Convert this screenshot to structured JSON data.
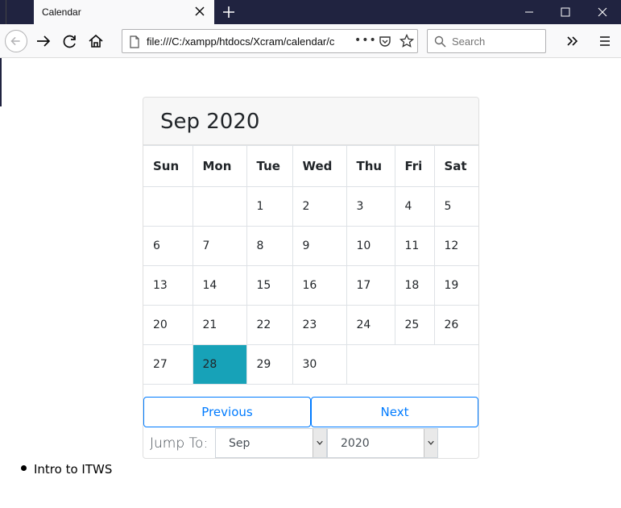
{
  "browser": {
    "tab_title": "Calendar",
    "url": "file:///C:/xampp/htdocs/Xcram/calendar/c",
    "more_label": "•••",
    "search_placeholder": "Search"
  },
  "calendar": {
    "header": "Sep 2020",
    "weekdays": [
      "Sun",
      "Mon",
      "Tue",
      "Wed",
      "Thu",
      "Fri",
      "Sat"
    ],
    "weeks": [
      [
        "",
        "",
        "1",
        "2",
        "3",
        "4",
        "5"
      ],
      [
        "6",
        "7",
        "8",
        "9",
        "10",
        "11",
        "12"
      ],
      [
        "13",
        "14",
        "15",
        "16",
        "17",
        "18",
        "19"
      ],
      [
        "20",
        "21",
        "22",
        "23",
        "24",
        "25",
        "26"
      ],
      [
        "27",
        "28",
        "29",
        "30",
        "",
        "",
        ""
      ]
    ],
    "today": "28",
    "highlight_color": "#17a2b8",
    "previous_label": "Previous",
    "next_label": "Next",
    "jump_label": "Jump To:",
    "month_selected": "Sep",
    "year_selected": "2020"
  },
  "links": [
    "Intro to ITWS"
  ]
}
